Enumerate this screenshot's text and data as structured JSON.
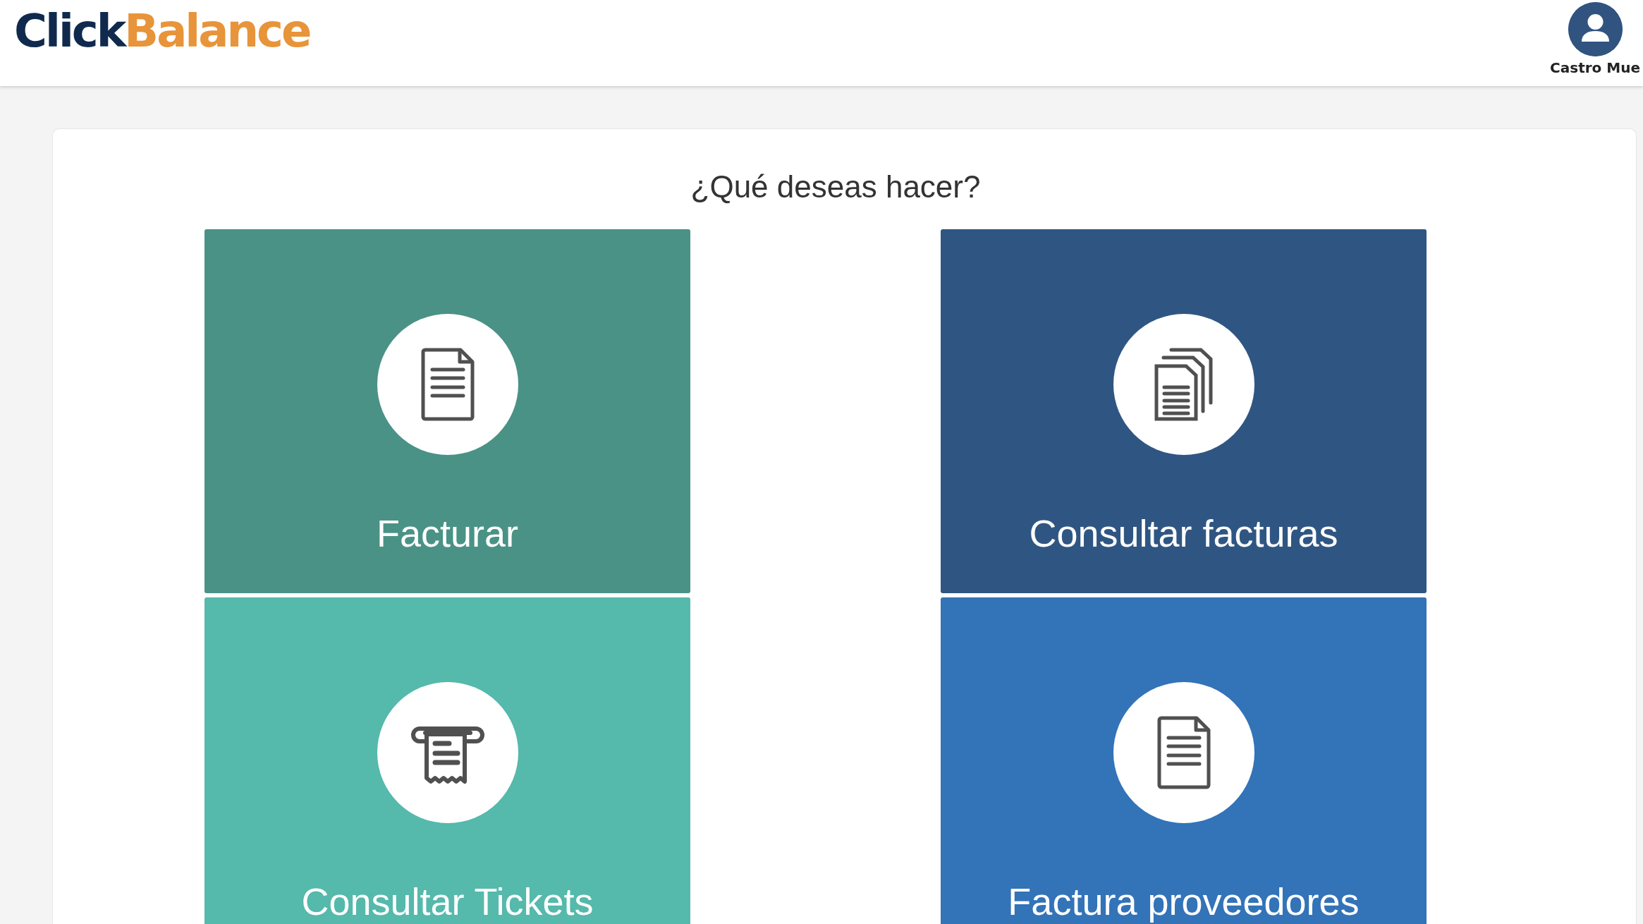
{
  "header": {
    "logo": {
      "text_1": "Click",
      "text_2": "Balance"
    },
    "user_name": "Castro Mue"
  },
  "panel": {
    "title": "¿Qué deseas hacer?",
    "tiles": [
      {
        "label": "Facturar",
        "kind": "document",
        "color": "#4a9285"
      },
      {
        "label": "Consultar facturas",
        "kind": "documents",
        "color": "#2f5683"
      },
      {
        "label": "Consultar Tickets",
        "kind": "receipt",
        "color": "#55b9ab"
      },
      {
        "label": "Factura proveedores",
        "kind": "document",
        "color": "#3373b8"
      }
    ]
  }
}
